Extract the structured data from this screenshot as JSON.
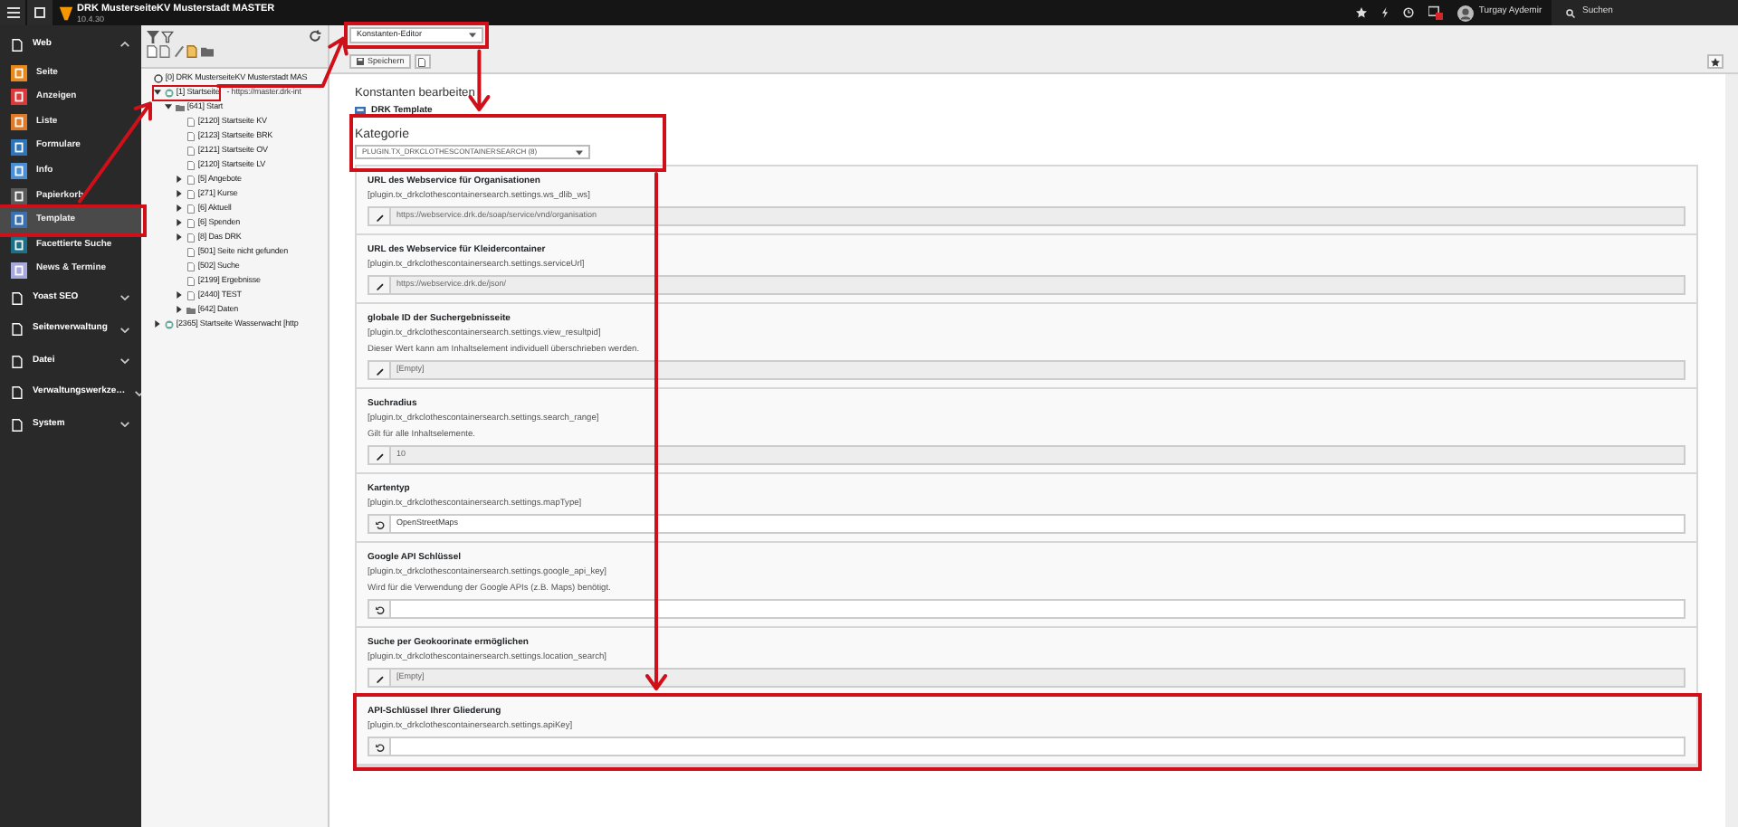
{
  "topbar": {
    "site_title": "DRK MusterseiteKV Musterstadt MASTER",
    "version": "10.4.30",
    "user": "Turgay Aydemir",
    "search": "Suchen"
  },
  "modules": [
    {
      "label": "Web",
      "expanded": true,
      "children": [
        {
          "label": "Seite",
          "color": "#e8891d",
          "selected": false,
          "highlighted": false
        },
        {
          "label": "Anzeigen",
          "color": "#d9393a",
          "selected": false,
          "highlighted": false
        },
        {
          "label": "Liste",
          "color": "#df7a2a",
          "selected": false,
          "highlighted": false
        },
        {
          "label": "Formulare",
          "color": "#2f73b8",
          "selected": false,
          "highlighted": false
        },
        {
          "label": "Info",
          "color": "#4a8fd6",
          "selected": false,
          "highlighted": false
        },
        {
          "label": "Papierkorb",
          "color": "#5a5a5a",
          "selected": false,
          "highlighted": false
        },
        {
          "label": "Template",
          "color": "#3a6fb0",
          "selected": true,
          "highlighted": true
        },
        {
          "label": "Facettierte Suche",
          "color": "#1b6f86",
          "selected": false,
          "highlighted": false
        },
        {
          "label": "News & Termine",
          "color": "#a6a9dc",
          "selected": false,
          "highlighted": false
        }
      ]
    },
    {
      "label": "Yoast SEO",
      "expanded": false
    },
    {
      "label": "Seitenverwaltung",
      "expanded": false
    },
    {
      "label": "Datei",
      "expanded": false
    },
    {
      "label": "Verwaltungswerkze…",
      "expanded": false
    },
    {
      "label": "System",
      "expanded": false
    }
  ],
  "tree": [
    {
      "label": "[0] DRK MusterseiteKV Musterstadt MAS",
      "kind": "root",
      "highlighted": false,
      "children": [
        {
          "label": "[1] Startseite",
          "url": "- https://master.drk-int",
          "kind": "site",
          "expanded": true,
          "highlighted": true,
          "children": [
            {
              "label": "[641] Start",
              "kind": "folder",
              "expanded": true,
              "highlighted": false,
              "children": [
                {
                  "label": "[2120] Startseite KV",
                  "kind": "page",
                  "highlighted": false
                },
                {
                  "label": "[2123] Startseite BRK",
                  "kind": "page",
                  "highlighted": false
                },
                {
                  "label": "[2121] Startseite OV",
                  "kind": "page",
                  "highlighted": false
                },
                {
                  "label": "[2120] Startseite LV",
                  "kind": "page",
                  "highlighted": false
                },
                {
                  "label": "[5] Angebote",
                  "kind": "page",
                  "expanded": false,
                  "highlighted": false
                },
                {
                  "label": "[271] Kurse",
                  "kind": "page",
                  "expanded": false,
                  "highlighted": false
                },
                {
                  "label": "[6] Aktuell",
                  "kind": "page",
                  "expanded": false,
                  "highlighted": false
                },
                {
                  "label": "[6] Spenden",
                  "kind": "page",
                  "expanded": false,
                  "highlighted": false
                },
                {
                  "label": "[8] Das DRK",
                  "kind": "page",
                  "expanded": false,
                  "highlighted": false
                },
                {
                  "label": "[501] Seite nicht gefunden",
                  "kind": "page",
                  "highlighted": false
                },
                {
                  "label": "[502] Suche",
                  "kind": "page",
                  "highlighted": false
                },
                {
                  "label": "[2199] Ergebnisse",
                  "kind": "page",
                  "highlighted": false
                },
                {
                  "label": "[2440] TEST",
                  "kind": "page",
                  "expanded": false,
                  "highlighted": false
                },
                {
                  "label": "[642] Daten",
                  "kind": "folder",
                  "expanded": false,
                  "highlighted": false
                }
              ]
            }
          ]
        },
        {
          "label": "[2365] Startseite Wasserwacht [http",
          "kind": "site",
          "expanded": false,
          "highlighted": false
        }
      ]
    }
  ],
  "docheader": {
    "function_select": {
      "value": "Konstanten-Editor",
      "highlighted": true
    },
    "save_button": "Speichern"
  },
  "content": {
    "heading": "Konstanten bearbeiten",
    "template": "DRK Template",
    "category": {
      "label": "Kategorie",
      "value": "PLUGIN.TX_DRKCLOTHESCONTAINERSEARCH (8)",
      "highlighted": true
    },
    "fields": [
      {
        "title": "URL des Webservice für Organisationen",
        "key": "[plugin.tx_drkclothescontainersearch.settings.ws_dlib_ws]",
        "value": "https://webservice.drk.de/soap/service/vnd/organisation",
        "modified": false,
        "highlighted": false
      },
      {
        "title": "URL des Webservice für Kleidercontainer",
        "key": "[plugin.tx_drkclothescontainersearch.settings.serviceUrl]",
        "value": "https://webservice.drk.de/json/",
        "modified": false,
        "highlighted": false
      },
      {
        "title": "globale ID der Suchergebnisseite",
        "key": "[plugin.tx_drkclothescontainersearch.settings.view_resultpid]",
        "description": "Dieser Wert kann am Inhaltselement individuell überschrieben werden.",
        "value": "[Empty]",
        "modified": false,
        "highlighted": false
      },
      {
        "title": "Suchradius",
        "key": "[plugin.tx_drkclothescontainersearch.settings.search_range]",
        "description": "Gilt für alle Inhaltselemente.",
        "value": "10",
        "modified": false,
        "highlighted": false
      },
      {
        "title": "Kartentyp",
        "key": "[plugin.tx_drkclothescontainersearch.settings.mapType]",
        "value": "OpenStreetMaps",
        "modified": true,
        "highlighted": false
      },
      {
        "title": "Google API Schlüssel",
        "key": "[plugin.tx_drkclothescontainersearch.settings.google_api_key]",
        "description": "Wird für die Verwendung der Google APIs (z.B. Maps) benötigt.",
        "modified": true,
        "highlighted": false
      },
      {
        "title": "Suche per Geokoorinate ermöglichen",
        "key": "[plugin.tx_drkclothescontainersearch.settings.location_search]",
        "value": "[Empty]",
        "modified": false,
        "highlighted": false
      },
      {
        "title": "API-Schlüssel Ihrer Gliederung",
        "key": "[plugin.tx_drkclothescontainersearch.settings.apiKey]",
        "modified": true,
        "highlighted": true
      }
    ]
  }
}
